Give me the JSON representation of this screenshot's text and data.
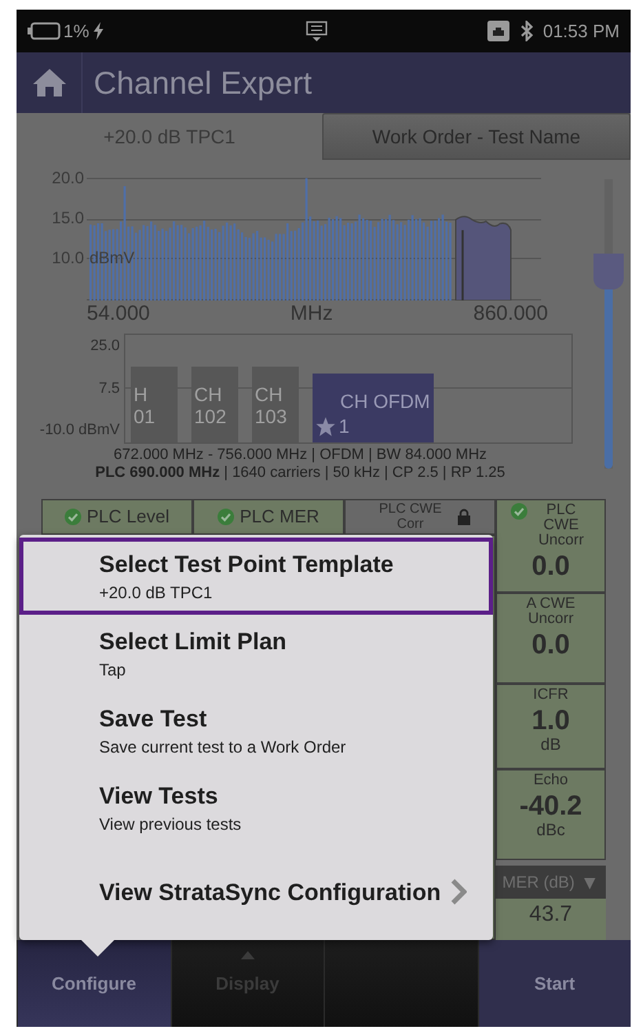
{
  "status_bar": {
    "battery": "1%",
    "time": "01:53 PM"
  },
  "app_bar": {
    "title": "Channel Expert"
  },
  "tabs": [
    {
      "label": "+20.0 dB TPC1",
      "selected": true
    },
    {
      "label": "Work Order - Test Name",
      "selected": false
    }
  ],
  "spectrum": {
    "yticks": [
      "20.0",
      "15.0",
      "10.0"
    ],
    "unit": "dBmV",
    "x_start": "54.000",
    "x_label": "MHz",
    "x_end": "860.000"
  },
  "channel_view": {
    "yticks": [
      "25.0",
      "7.5",
      "-10.0"
    ],
    "unit": "dBmV",
    "channels": [
      {
        "kind": "qam",
        "lines": [
          "H",
          "01"
        ],
        "selected": false
      },
      {
        "kind": "qam",
        "lines": [
          "CH",
          "102"
        ],
        "selected": false
      },
      {
        "kind": "qam",
        "lines": [
          "CH",
          "103"
        ],
        "selected": false
      },
      {
        "kind": "ofdm",
        "lines": [
          "CH OFDM",
          "1"
        ],
        "selected": true
      }
    ]
  },
  "channel_info": [
    "672.000 MHz - 756.000 MHz | OFDM | BW 84.000 MHz",
    "**PLC 690.000 MHz** | 1640 carriers | 50 kHz | CP 2.5 | RP 1.25"
  ],
  "level_slider": {
    "level": 0.68
  },
  "results": {
    "headers": [
      {
        "label": "PLC Level",
        "passed": true,
        "locked": false
      },
      {
        "label": "PLC MER",
        "passed": true,
        "locked": false
      },
      {
        "label": "PLC CWE Corr",
        "passed": false,
        "locked": true
      }
    ],
    "side": [
      {
        "label": "PLC CWE Uncorr",
        "passed": true,
        "value": "0.0"
      },
      {
        "label": "A CWE Uncorr",
        "passed": false,
        "value": "0.0"
      },
      {
        "label": "ICFR",
        "passed": false,
        "value": "1.0",
        "unit": "dB"
      },
      {
        "label": "Echo",
        "passed": false,
        "value": "-40.2",
        "unit": "dBc"
      }
    ],
    "table_header": {
      "label": "MER (dB)",
      "sort": "▼"
    },
    "rows": [
      "43.7"
    ]
  },
  "menu": {
    "items": [
      {
        "kind": "item",
        "title": "Select Test Point Template",
        "subtitle": "+20.0 dB TPC1",
        "selected": true
      },
      {
        "kind": "item",
        "title": "Select Limit Plan",
        "subtitle": "Tap",
        "selected": false
      },
      {
        "kind": "item",
        "title": "Save Test",
        "subtitle": "Save current test to a Work Order",
        "selected": false
      },
      {
        "kind": "item",
        "title": "View Tests",
        "subtitle": "View previous tests",
        "selected": false
      },
      {
        "kind": "submenu",
        "title": "View StrataSync Configuration",
        "selected": false
      }
    ]
  },
  "bottom_bar": [
    {
      "kind": "button",
      "label": "Configure",
      "selected": true,
      "disabled": false
    },
    {
      "kind": "button",
      "label": "Display",
      "selected": false,
      "disabled": true
    },
    {
      "kind": "empty"
    },
    {
      "kind": "button",
      "label": "Start",
      "selected": false,
      "disabled": false
    }
  ]
}
